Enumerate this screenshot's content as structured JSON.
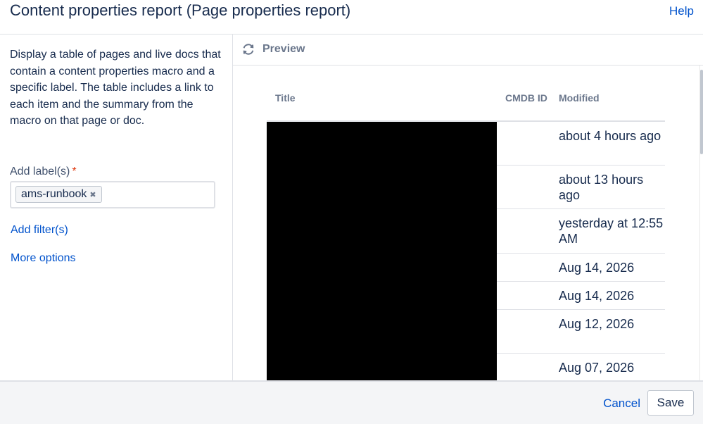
{
  "dialog": {
    "title": "Content properties report (Page properties report)",
    "help_label": "Help"
  },
  "sidebar": {
    "description": "Display a table of pages and live docs that contain a content properties macro and a specific label. The table includes a link to each item and the summary from the macro on that page or doc.",
    "label_field_label": "Add label(s)",
    "required_marker": "*",
    "labels": [
      "ams-runbook"
    ],
    "remove_label_glyph": "✖",
    "add_filter_label": "Add filter(s)",
    "more_options_label": "More options"
  },
  "preview": {
    "title": "Preview",
    "icon": "refresh-icon",
    "columns": [
      "Title",
      "CMDB ID",
      "Modified"
    ],
    "rows": [
      {
        "title": "",
        "cmdb_id": "",
        "modified": "about 4 hours ago"
      },
      {
        "title": "",
        "cmdb_id": "",
        "modified": "about 13 hours ago"
      },
      {
        "title": "",
        "cmdb_id": "",
        "modified": "yesterday at 12:55 AM"
      },
      {
        "title": "",
        "cmdb_id": "",
        "modified": "Aug 14, 2026"
      },
      {
        "title": "",
        "cmdb_id": "",
        "modified": "Aug 14, 2026"
      },
      {
        "title": "",
        "cmdb_id": "",
        "modified": "Aug 12, 2026"
      },
      {
        "title": "",
        "cmdb_id": "",
        "modified": "Aug 07, 2026"
      }
    ]
  },
  "footer": {
    "cancel_label": "Cancel",
    "save_label": "Save"
  },
  "colors": {
    "link": "#0052cc",
    "text": "#172b4d",
    "muted": "#6b778c",
    "required": "#de350b",
    "redaction": "#000000"
  }
}
